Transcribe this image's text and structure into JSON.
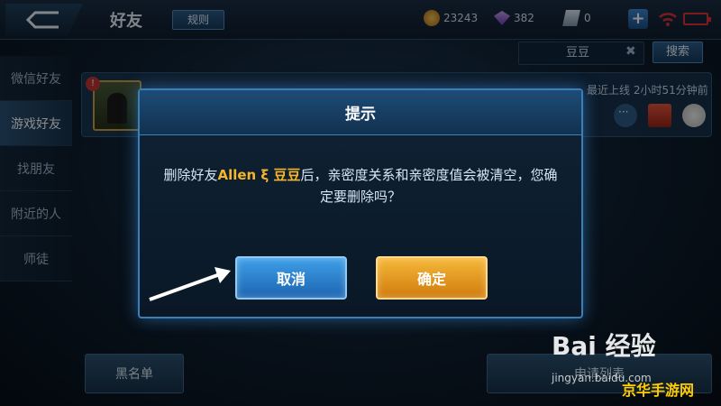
{
  "header": {
    "title": "好友",
    "rules_label": "规则",
    "gold": "23243",
    "diamonds": "382",
    "tickets": "0",
    "plus_label": "+"
  },
  "sidebar": {
    "items": [
      {
        "label": "微信好友"
      },
      {
        "label": "游戏好友"
      },
      {
        "label": "找朋友"
      },
      {
        "label": "附近的人"
      },
      {
        "label": "师徒"
      }
    ]
  },
  "search": {
    "value": "豆豆",
    "clear_label": "✖",
    "button_label": "搜索"
  },
  "friend_card": {
    "last_online": "最近上线  2小时51分钟前"
  },
  "bottom": {
    "blacklist_label": "黑名单",
    "requests_label": "申请列表"
  },
  "dialog": {
    "title": "提示",
    "message_prefix": "删除好友",
    "friend_name": "Allen ξ 豆豆",
    "message_suffix": "后，亲密度关系和亲密度值会被清空，您确定要删除吗？",
    "cancel_label": "取消",
    "confirm_label": "确定"
  },
  "watermark": {
    "baidu": "Bai 经验",
    "baidu_url": "jingyan.baidu.com",
    "site": "京华手游网"
  },
  "colors": {
    "accent_blue": "#3ea0e8",
    "accent_orange": "#f5b83a",
    "highlight": "#f4b52b"
  }
}
